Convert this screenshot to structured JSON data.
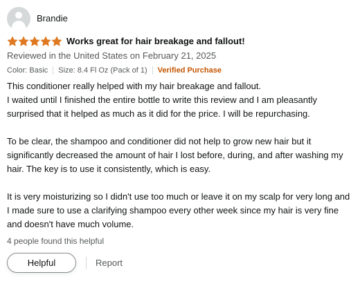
{
  "review": {
    "profile_name": "Brandie",
    "rating": 5,
    "star_color": "#de7921",
    "title": "Works great for hair breakage and fallout!",
    "date_line": "Reviewed in the United States on February 21, 2025",
    "format": {
      "color": "Color: Basic",
      "size": "Size: 8.4 Fl Oz (Pack of 1)",
      "verified": "Verified Purchase"
    },
    "body": {
      "p1_line1": "This conditioner really helped with my hair breakage and fallout.",
      "p1_rest": "I waited until I finished the entire bottle to write this review and I am pleasantly surprised that it helped as much as it did for the price. I will be repurchasing.",
      "p2": "To be clear, the shampoo and conditioner did not help to grow new hair but it significantly decreased the amount of hair I lost before, during, and after washing my hair. The key is to use it consistently, which is easy.",
      "p3": "It is very moisturizing so I didn't use too much or leave it on my scalp for very long and I made sure to use a clarifying shampoo every other week since my hair is very fine and doesn't have much volume."
    },
    "helpful_count": "4 people found this helpful",
    "helpful_button": "Helpful",
    "report_link": "Report"
  },
  "icons": {
    "avatar": "avatar-icon",
    "star": "star-icon"
  }
}
